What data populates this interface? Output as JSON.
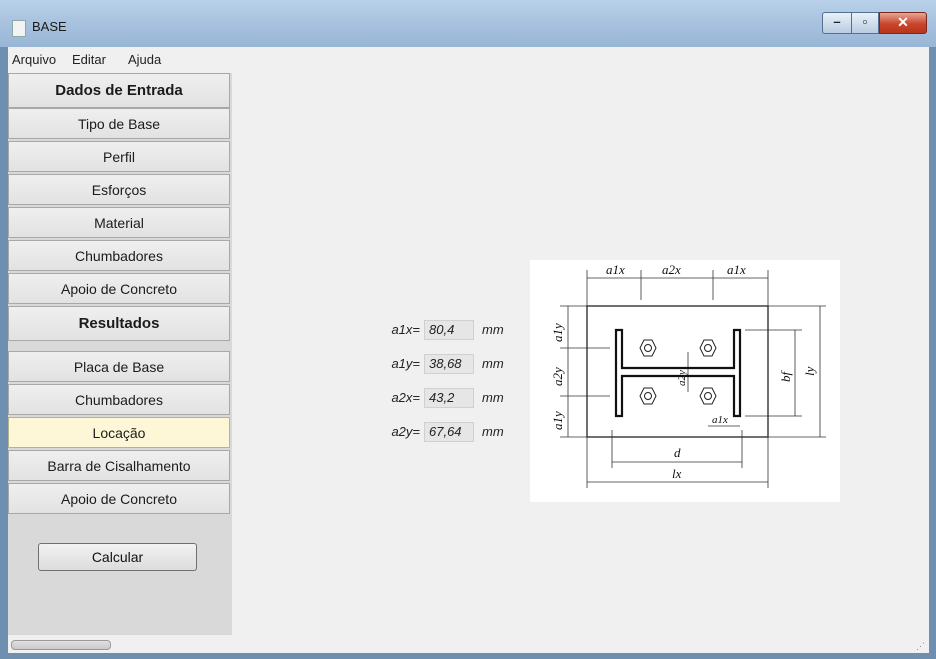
{
  "window": {
    "title": "BASE"
  },
  "menu": [
    "Arquivo",
    "Editar",
    "Ajuda"
  ],
  "sidebar": {
    "items": [
      {
        "label": "Dados de Entrada"
      },
      {
        "label": "Tipo de Base"
      },
      {
        "label": "Perfil"
      },
      {
        "label": "Esforços"
      },
      {
        "label": "Material"
      },
      {
        "label": "Chumbadores"
      },
      {
        "label": "Apoio de Concreto"
      },
      {
        "label": "Resultados"
      },
      {
        "label": "Placa de Base"
      },
      {
        "label": "Chumbadores"
      },
      {
        "label": "Locação",
        "selected": true
      },
      {
        "label": "Barra de Cisalhamento"
      },
      {
        "label": "Apoio de Concreto"
      }
    ],
    "calculate_label": "Calcular"
  },
  "fields": [
    {
      "label": "a1x=",
      "value": "80,4",
      "unit": "mm"
    },
    {
      "label": "a1y=",
      "value": "38,68",
      "unit": "mm"
    },
    {
      "label": "a2x=",
      "value": "43,2",
      "unit": "mm"
    },
    {
      "label": "a2y=",
      "value": "67,64",
      "unit": "mm"
    }
  ],
  "diagram": {
    "labels": {
      "a1x_top_left": "a1x",
      "a2x_top": "a2x",
      "a1x_top_right": "a1x",
      "a1y_left_top": "a1y",
      "a2y_left": "a2y",
      "a1y_left_bottom": "a1y",
      "a2y_inner": "a2y",
      "a1x_inner": "a1x",
      "d": "d",
      "lx": "lx",
      "bf": "bf",
      "ly": "ly"
    }
  },
  "colors": {
    "selected_bg": "#fdf7d7",
    "titlebar": "#a9c3df",
    "close_button": "#c9452b"
  }
}
